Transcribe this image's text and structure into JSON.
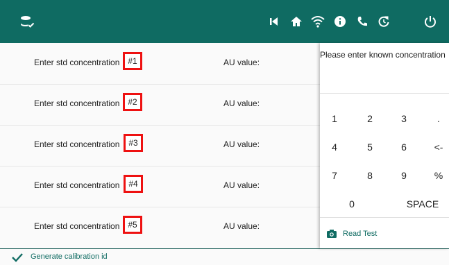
{
  "header": {
    "icons": [
      "database-check-icon",
      "skip-back-icon",
      "home-icon",
      "wifi-icon",
      "info-icon",
      "phone-icon",
      "refresh-icon",
      "power-icon"
    ]
  },
  "rows": [
    {
      "label": "Enter std concentration",
      "value": "#1",
      "au_label": "AU value:"
    },
    {
      "label": "Enter std concentration",
      "value": "#2",
      "au_label": "AU value:"
    },
    {
      "label": "Enter std concentration",
      "value": "#3",
      "au_label": "AU value:"
    },
    {
      "label": "Enter std concentration",
      "value": "#4",
      "au_label": "AU value:"
    },
    {
      "label": "Enter std concentration",
      "value": "#5",
      "au_label": "AU value:"
    }
  ],
  "footer": {
    "generate_label": "Generate calibration id"
  },
  "keypad": {
    "prompt": "Please enter known concentration",
    "keys": [
      "1",
      "2",
      "3",
      ".",
      "4",
      "5",
      "6",
      "<-",
      "7",
      "8",
      "9",
      "%",
      "0",
      "SPACE"
    ],
    "read_test_label": "Read Test"
  },
  "colors": {
    "brand": "#0f6b62",
    "highlight": "#e11111"
  }
}
